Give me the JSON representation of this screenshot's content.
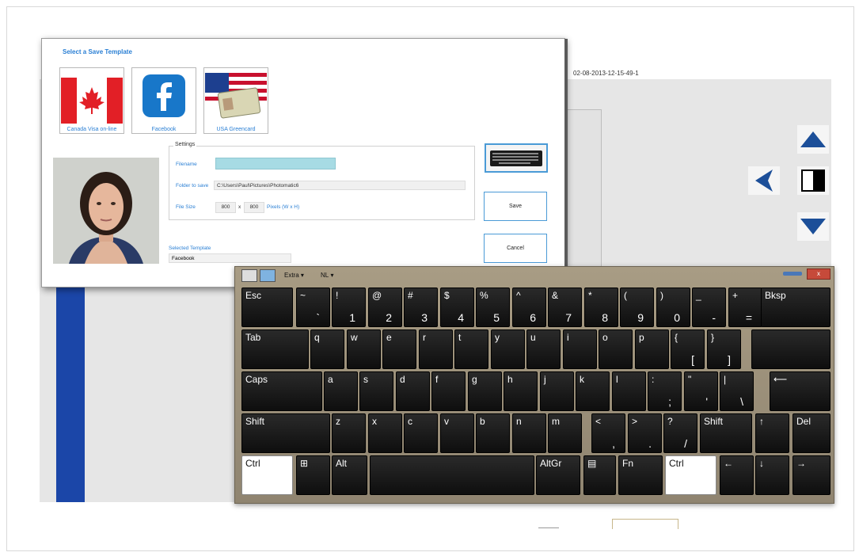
{
  "background_app": {
    "timestamp": "02-08-2013-12-15-49-1",
    "nav": [
      "up-arrow",
      "left-arrow",
      "contrast",
      "down-arrow"
    ]
  },
  "dialog": {
    "title": "Select a Save Template",
    "templates": [
      {
        "label": "Canada Visa on-line"
      },
      {
        "label": "Facebook"
      },
      {
        "label": "USA Greencard"
      }
    ],
    "settings": {
      "legend": "Settings",
      "filename_label": "Filename",
      "filename_value": "",
      "folder_label": "Folder to save",
      "folder_value": "C:\\Users\\Paul\\Pictures\\Photomatic6",
      "filesize_label": "File Size",
      "width": "800",
      "x": "x",
      "height": "800",
      "units": "Pixels (W x H)"
    },
    "selected_template_label": "Selected Template",
    "selected_template_value": "Facebook",
    "save_label": "Save",
    "cancel_label": "Cancel"
  },
  "keyboard": {
    "menu": {
      "extra": "Extra",
      "lang": "NL"
    },
    "close": "x",
    "rows": [
      [
        {
          "t": "Esc"
        },
        {
          "t": "~",
          "b": "`"
        },
        {
          "t": "!",
          "b": "1"
        },
        {
          "t": "@",
          "b": "2"
        },
        {
          "t": "#",
          "b": "3"
        },
        {
          "t": "$",
          "b": "4"
        },
        {
          "t": "%",
          "b": "5"
        },
        {
          "t": "^",
          "b": "6"
        },
        {
          "t": "&",
          "b": "7"
        },
        {
          "t": "*",
          "b": "8"
        },
        {
          "t": "(",
          "b": "9"
        },
        {
          "t": ")",
          "b": "0"
        },
        {
          "t": "_",
          "b": "-"
        },
        {
          "t": "+",
          "b": "="
        },
        {
          "t": "Bksp"
        }
      ],
      [
        {
          "t": "Tab"
        },
        {
          "t": "q"
        },
        {
          "t": "w"
        },
        {
          "t": "e"
        },
        {
          "t": "r"
        },
        {
          "t": "t"
        },
        {
          "t": "y"
        },
        {
          "t": "u"
        },
        {
          "t": "i"
        },
        {
          "t": "o"
        },
        {
          "t": "p"
        },
        {
          "t": "{",
          "b": "["
        },
        {
          "t": "}",
          "b": "]"
        },
        {
          "t": ""
        }
      ],
      [
        {
          "t": "Caps"
        },
        {
          "t": "a"
        },
        {
          "t": "s"
        },
        {
          "t": "d"
        },
        {
          "t": "f"
        },
        {
          "t": "g"
        },
        {
          "t": "h"
        },
        {
          "t": "j"
        },
        {
          "t": "k"
        },
        {
          "t": "l"
        },
        {
          "t": ":",
          "b": ";"
        },
        {
          "t": "\"",
          "b": "'"
        },
        {
          "t": "|",
          "b": "\\"
        },
        {
          "t": "⟵"
        }
      ],
      [
        {
          "t": "Shift"
        },
        {
          "t": "z"
        },
        {
          "t": "x"
        },
        {
          "t": "c"
        },
        {
          "t": "v"
        },
        {
          "t": "b"
        },
        {
          "t": "n"
        },
        {
          "t": "m"
        },
        {
          "t": "<",
          "b": ","
        },
        {
          "t": ">",
          "b": "."
        },
        {
          "t": "?",
          "b": "/"
        },
        {
          "t": "Shift"
        },
        {
          "t": "↑"
        },
        {
          "t": "Del"
        }
      ],
      [
        {
          "t": "Ctrl"
        },
        {
          "t": "⊞"
        },
        {
          "t": "Alt"
        },
        {
          "t": ""
        },
        {
          "t": "AltGr"
        },
        {
          "t": "▤"
        },
        {
          "t": "Fn"
        },
        {
          "t": "Ctrl"
        },
        {
          "t": "←"
        },
        {
          "t": "↓"
        },
        {
          "t": "→"
        }
      ]
    ]
  }
}
